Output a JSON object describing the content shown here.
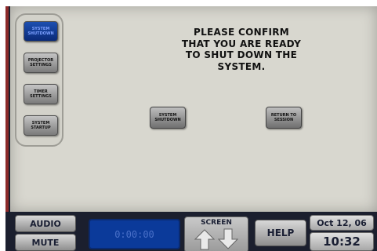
{
  "sidebar": {
    "items": [
      {
        "label": "SYSTEM SHUTDOWN",
        "active": true
      },
      {
        "label": "PROJECTOR SETTINGS",
        "active": false
      },
      {
        "label": "TIMER SETTINGS",
        "active": false
      },
      {
        "label": "SYSTEM STARTUP",
        "active": false
      }
    ]
  },
  "main": {
    "message_lines": [
      "PLEASE CONFIRM",
      "THAT YOU ARE READY",
      "TO SHUT DOWN THE",
      "SYSTEM."
    ],
    "shutdown_button": "SYSTEM SHUTDOWN",
    "return_button": "RETURN TO SESSION"
  },
  "bottom": {
    "audio_label": "AUDIO",
    "mute_label": "MUTE",
    "timer_value": "0:00:00",
    "screen_label": "SCREEN",
    "help_label": "HELP",
    "date": "Oct 12, 06",
    "time": "10:32"
  },
  "colors": {
    "screen_bg": "#d8d7cf",
    "frame": "#1b1f2e",
    "active_button": "#0a2a78",
    "timer_bg": "#0b3a9a"
  }
}
